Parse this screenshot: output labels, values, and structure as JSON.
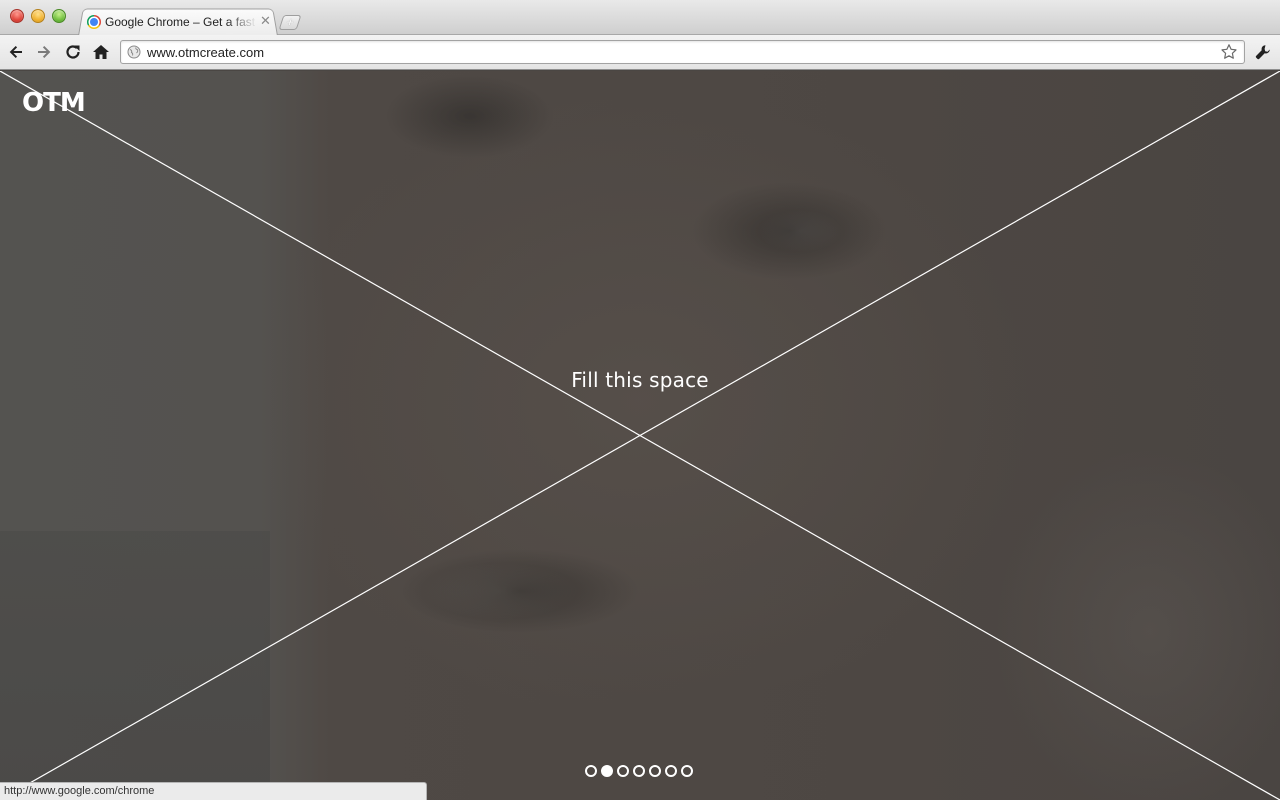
{
  "tab": {
    "title": "Google Chrome – Get a fast new browser. For PC, Mac, and Linux",
    "close_glyph": "✕"
  },
  "new_tab_glyph": "+",
  "omnibox": {
    "url": "www.otmcreate.com"
  },
  "page": {
    "logo": "OTM",
    "headline": "Fill this space",
    "slides": {
      "count": 7,
      "active_index": 1
    }
  },
  "status_bar": {
    "text": "http://www.google.com/chrome"
  },
  "icons": {
    "back": "back-arrow-icon",
    "forward": "forward-arrow-icon",
    "reload": "reload-icon",
    "home": "home-icon",
    "globe": "globe-icon",
    "star": "bookmark-star-icon",
    "wrench": "wrench-icon"
  },
  "colors": {
    "page_background": "#4a4643",
    "overlay_text": "#ffffff"
  }
}
